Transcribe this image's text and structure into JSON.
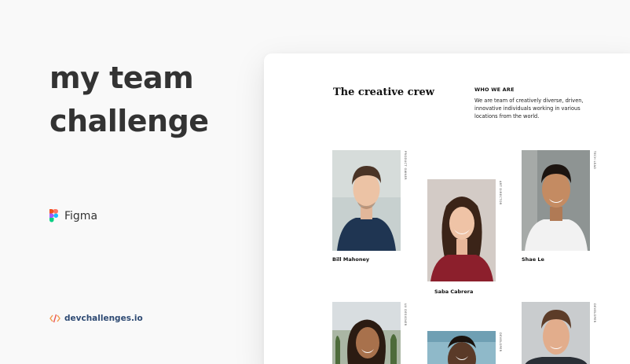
{
  "headline": {
    "line1": "my team",
    "line2": "challenge"
  },
  "tool": {
    "label": "Figma",
    "icon": "figma-icon"
  },
  "brand": {
    "label": "devchallenges.io",
    "icon": "code-brackets-icon"
  },
  "card": {
    "title": "The creative crew",
    "who_heading": "WHO WE ARE",
    "who_text": "We are team of creatively diverse, driven, innovative individuals working in various locations from the world."
  },
  "members": [
    {
      "name": "Bill Mahoney",
      "role": "PRODUCT OWNER"
    },
    {
      "name": "Saba Cabrera",
      "role": "ART DIRECTOR"
    },
    {
      "name": "Shae Le",
      "role": "TECH LEAD"
    },
    {
      "name": "",
      "role": "UX DESIGNER"
    },
    {
      "name": "",
      "role": "DEVELOPER"
    },
    {
      "name": "",
      "role": "DEVELOPER"
    }
  ],
  "colors": {
    "page_bg": "#f9f9f9",
    "card_bg": "#ffffff",
    "headline": "#333333",
    "brand_text": "#2e4a73"
  }
}
